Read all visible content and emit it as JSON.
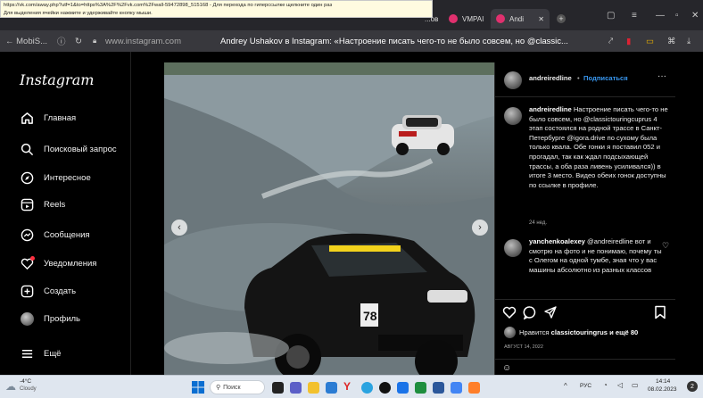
{
  "tooltip": {
    "line1": "https://vk.com/away.php?utf=1&to=https%3A%2F%2Fvk.com%2Fwall-59472898_515168 - Для перехода по гиперссылке щелкните один раз",
    "line2": "Для выделения ячейки нажмите и удерживайте кнопку мыши."
  },
  "browser": {
    "tabs": [
      {
        "label": "...ов",
        "active": false
      },
      {
        "label": "VMPAI",
        "active": false
      },
      {
        "label": "Andi",
        "active": true
      }
    ],
    "back_label": "← MobiS...",
    "url": "www.instagram.com",
    "page_title": "Andrey Ushakov в Instagram: «Настроение писать чего-то не было совсем, но @classic..."
  },
  "sidebar": {
    "logo": "Instagram",
    "items": [
      {
        "label": "Главная",
        "icon": "home-icon"
      },
      {
        "label": "Поисковый запрос",
        "icon": "search-icon"
      },
      {
        "label": "Интересное",
        "icon": "explore-icon"
      },
      {
        "label": "Reels",
        "icon": "reels-icon"
      },
      {
        "label": "Сообщения",
        "icon": "messenger-icon"
      },
      {
        "label": "Уведомления",
        "icon": "heart-icon"
      },
      {
        "label": "Создать",
        "icon": "create-icon"
      },
      {
        "label": "Профиль",
        "icon": "profile-icon"
      },
      {
        "label": "Ещё",
        "icon": "menu-icon"
      }
    ]
  },
  "post": {
    "author": "andreiredline",
    "follow": "Подписаться",
    "more": "···",
    "caption_author": "andreiredline",
    "caption": "Настроение писать чего-то не было совсем, но @classictouringcuprus 4 этап состоялся на родной трассе в Санкт-Петербурге @igora.drive по сухому была только квала. Обе гонки я поставил 052 и прогадал, так как ждал подсыхающей трассы, а оба раза ливень усиливался)) в итоге 3 место. Видео обеих гонок доступны по ссылке в профиле.",
    "caption_age": "24 нед.",
    "comment_author": "yanchenkoalexey",
    "comment_text": "@andreiredline вот и смотрю на фото и не понимаю, почему ты с Олегом на одной тумбе, зная что у вас машины абсолютно из разных классов",
    "likes_prefix": "Нравится",
    "likes_user": "classictouringrus",
    "likes_suffix": "и ещё 80",
    "date": "АВГУСТ 14, 2022",
    "car_number": "78"
  },
  "taskbar": {
    "temp": "-4°C",
    "weather": "Cloudy",
    "search_placeholder": "Поиск",
    "lang": "РУС",
    "time": "14:14",
    "date": "08.02.2023",
    "notif_count": "2"
  }
}
